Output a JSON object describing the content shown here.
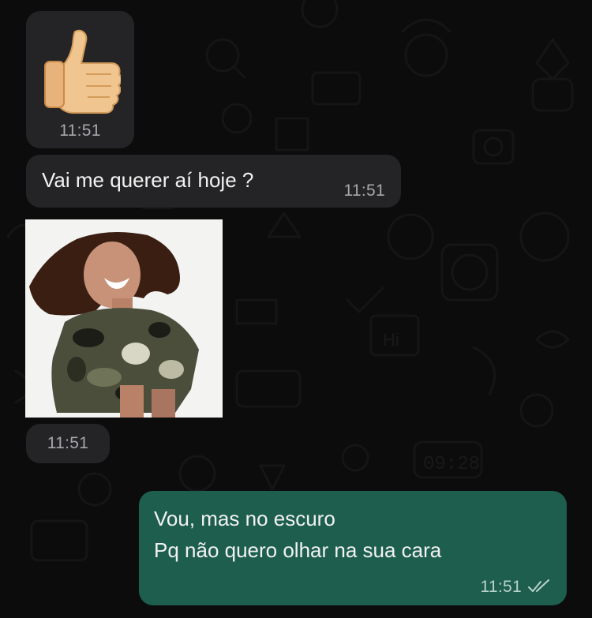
{
  "conversation": {
    "messages": [
      {
        "kind": "sticker",
        "direction": "incoming",
        "sticker_icon": "thumbs-up-icon",
        "time": "11:51"
      },
      {
        "kind": "text",
        "direction": "incoming",
        "text": "Vai me querer aí hoje ?",
        "time": "11:51"
      },
      {
        "kind": "gif",
        "direction": "incoming",
        "time": "11:51"
      },
      {
        "kind": "text",
        "direction": "outgoing",
        "lines": [
          "Vou, mas no escuro",
          "Pq não quero olhar na sua cara"
        ],
        "time": "11:51",
        "status_icon": "read-double-check-icon"
      }
    ]
  },
  "wallpaper": {
    "doodle_clock_text": "09:28",
    "doodle_hi_text": "Hi"
  },
  "colors": {
    "background": "#0c0c0c",
    "incoming_bubble": "#242426",
    "outgoing_bubble": "#1d5e4e",
    "time_text": "#a7a7ab"
  }
}
